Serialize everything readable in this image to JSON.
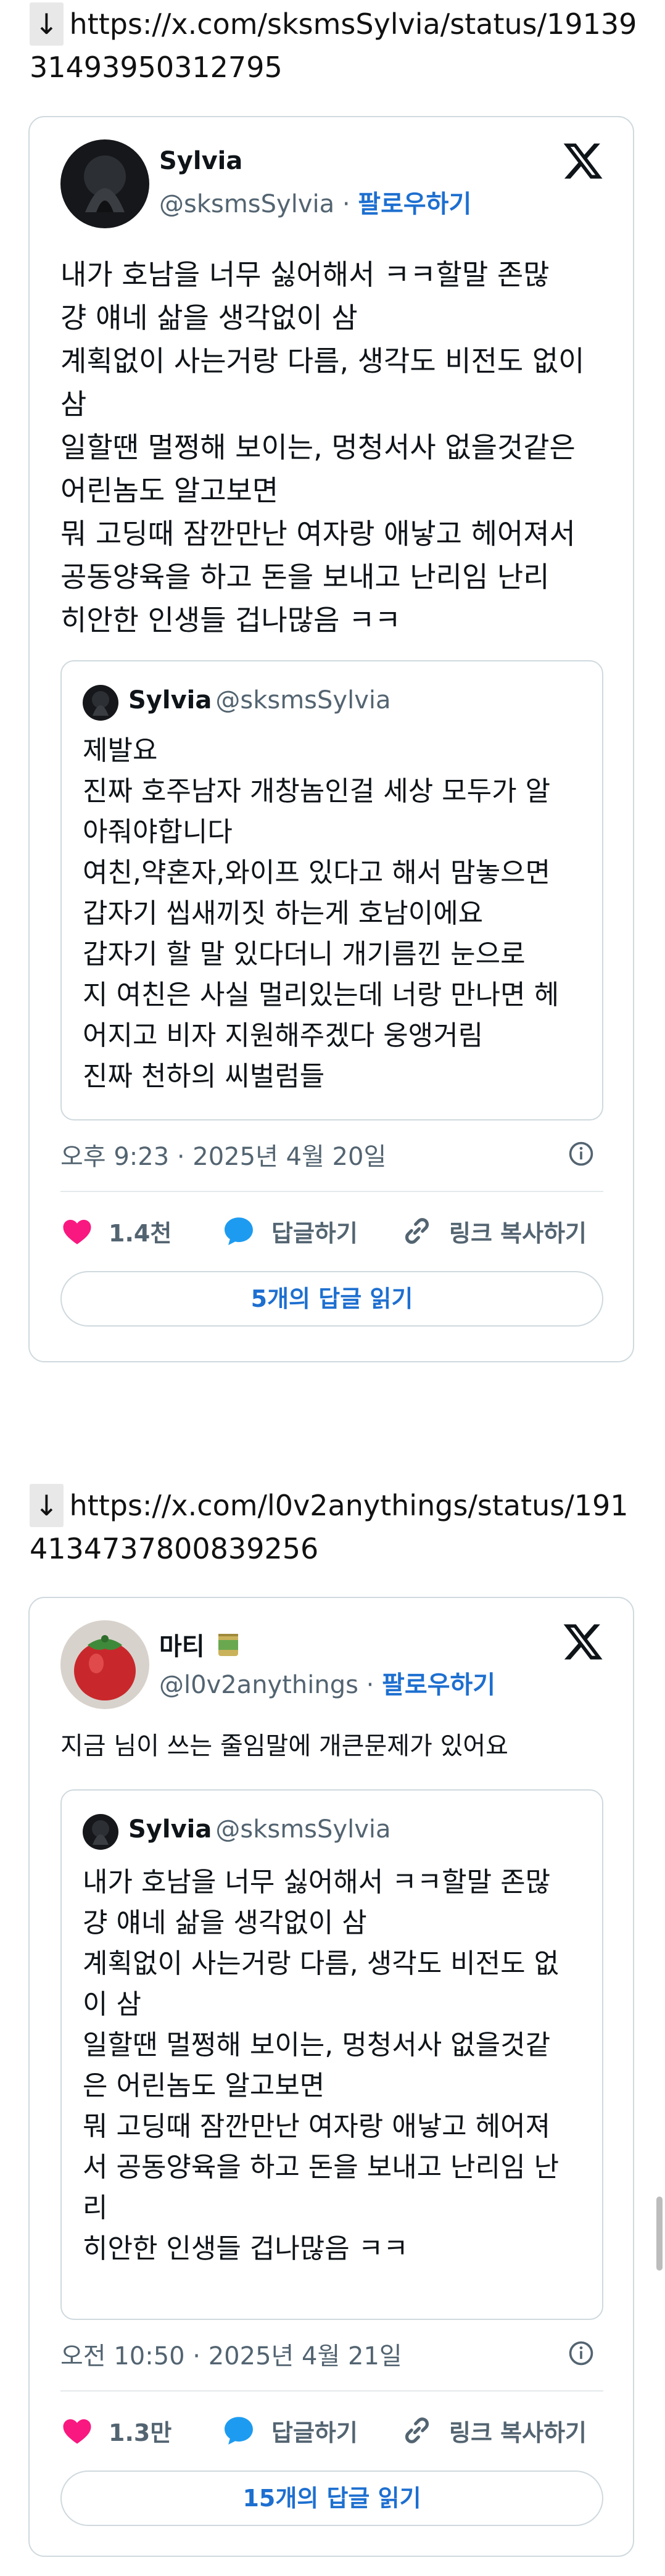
{
  "post1": {
    "url_arrow": "↓",
    "url": "https://x.com/sksmsSylvia/status/1913931493950312795",
    "author_name": "Sylvia",
    "author_handle": "@sksmsSylvia",
    "follow_label": "팔로우하기",
    "body": "내가 호남을 너무 싫어해서 ㅋㅋ할말 존많\n걍 얘네 삶을 생각없이 삼\n계획없이 사는거랑 다름, 생각도 비전도 없이\n삼\n일할땐 멀쩡해 보이는, 멍청서사 없을것같은\n어린놈도 알고보면\n뭐 고딩때 잠깐만난 여자랑 애낳고 헤어져서\n공동양육을 하고 돈을 보내고 난리임 난리\n히안한 인생들 겁나많음 ㅋㅋ",
    "quote": {
      "author_name": "Sylvia",
      "author_handle": "@sksmsSylvia",
      "body": "제발요\n진짜 호주남자 개창놈인걸 세상 모두가 알\n아줘야합니다\n여친,약혼자,와이프 있다고 해서 맘놓으면\n갑자기 씹새끼짓 하는게 호남이에요\n갑자기 할 말 있다더니 개기름낀 눈으로\n지 여친은 사실 멀리있는데 너랑 만나면 헤\n어지고 비자 지원해주겠다 웅앵거림\n진짜 천하의 씨벌럼들"
    },
    "timestamp": "오후 9:23 · 2025년 4월 20일",
    "likes": "1.4천",
    "reply_label": "답글하기",
    "copy_link_label": "링크 복사하기",
    "read_replies": "5개의 답글 읽기"
  },
  "post2": {
    "url_arrow": "↓",
    "url": "https://x.com/l0v2anythings/status/1914134737800839256",
    "author_name": "마티",
    "author_emoji": "🥫",
    "author_handle": "@l0v2anythings",
    "follow_label": "팔로우하기",
    "body": "지금 님이 쓰는 줄임말에 개큰문제가 있어요",
    "quote": {
      "author_name": "Sylvia",
      "author_handle": "@sksmsSylvia",
      "body": "내가 호남을 너무 싫어해서 ㅋㅋ할말 존많\n걍 얘네 삶을 생각없이 삼\n계획없이 사는거랑 다름, 생각도 비전도 없\n이 삼\n일할땐 멀쩡해 보이는, 멍청서사 없을것같\n은 어린놈도 알고보면\n뭐 고딩때 잠깐만난 여자랑 애낳고 헤어져\n서 공동양육을 하고 돈을 보내고 난리임 난\n리\n히안한 인생들 겁나많음 ㅋㅋ"
    },
    "timestamp": "오전 10:50 · 2025년 4월 21일",
    "likes": "1.3만",
    "reply_label": "답글하기",
    "copy_link_label": "링크 복사하기",
    "read_replies": "15개의 답글 읽기"
  },
  "colors": {
    "heart": "#f91880",
    "reply_bubble": "#1d9bf0",
    "link_blue": "#1d6fd0",
    "border": "#cfd9de",
    "muted": "#536471"
  }
}
